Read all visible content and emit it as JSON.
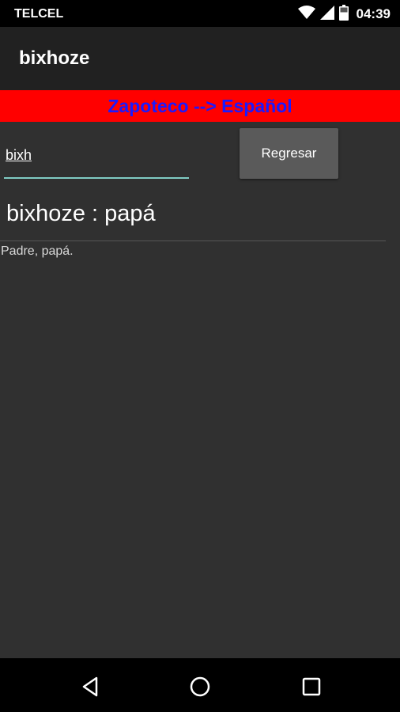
{
  "status_bar": {
    "carrier": "TELCEL",
    "time": "04:39",
    "icons": [
      "wifi-icon",
      "signal-icon",
      "battery-icon"
    ]
  },
  "app_bar": {
    "title": "bixhoze"
  },
  "banner": {
    "text": "Zapoteco --> Español",
    "background": "#ff0000",
    "text_color": "#1a1aff"
  },
  "search": {
    "value": "bixh",
    "underline_color": "#80cbc4"
  },
  "regresar_button": {
    "label": "Regresar"
  },
  "result": {
    "title": "bixhoze : papá",
    "definition": "Padre, papá."
  },
  "nav_bar": {
    "icons": [
      "back-icon",
      "home-icon",
      "recents-icon"
    ]
  }
}
